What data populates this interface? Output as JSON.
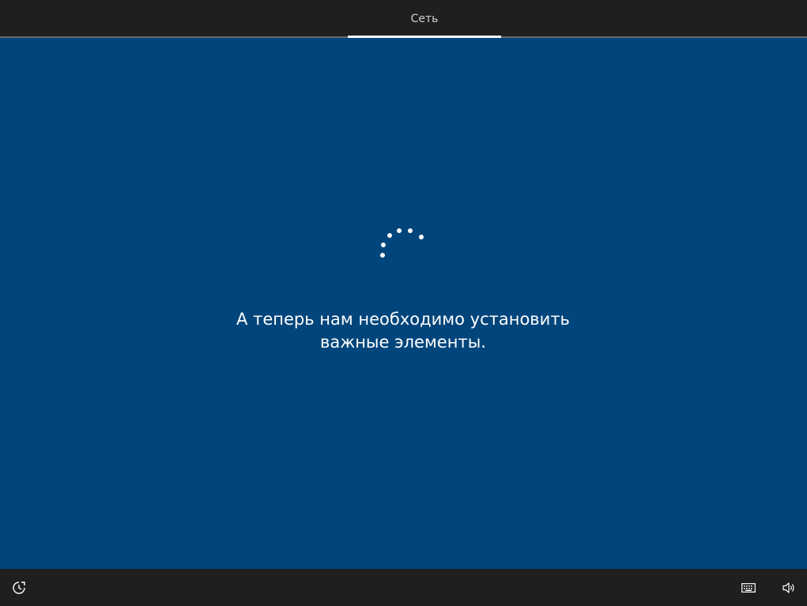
{
  "header": {
    "active_tab": "Сеть"
  },
  "main": {
    "message_line1": "А теперь нам необходимо установить",
    "message_line2": "важные элементы."
  },
  "footer": {
    "icons": {
      "left": "ease-of-access-icon",
      "keyboard": "keyboard-icon",
      "volume": "volume-icon"
    }
  },
  "colors": {
    "background": "#00457b",
    "bars": "#1f1f1f",
    "text": "#ffffff"
  }
}
